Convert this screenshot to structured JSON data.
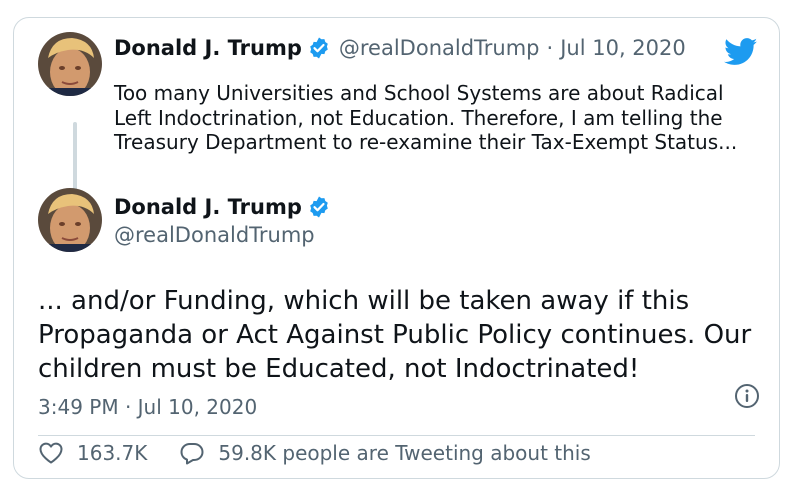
{
  "colors": {
    "verified": "#1d9bf0",
    "twitter_blue": "#1d9bf0",
    "text_primary": "#0f1419",
    "text_secondary": "#536471",
    "border": "#cfd9de"
  },
  "quoted_tweet": {
    "author_name": "Donald J. Trump",
    "handle": "@realDonaldTrump",
    "separator": "·",
    "date": "Jul 10, 2020",
    "text": "Too many Universities and School Systems are about Radical Left Indoctrination, not Education. Therefore, I am telling the Treasury Department to re-examine their Tax-Exempt Status...",
    "avatar_icon": "avatar-photo"
  },
  "main_tweet": {
    "author_name": "Donald J. Trump",
    "handle": "@realDonaldTrump",
    "text": "... and/or Funding, which will be taken away if this Propaganda or Act Against Public Policy continues. Our children must be Educated, not Indoctrinated!",
    "timestamp": "3:49 PM · Jul 10, 2020",
    "avatar_icon": "avatar-photo"
  },
  "icons": {
    "logo": "twitter-bird-icon",
    "verified": "verified-badge-icon",
    "info": "info-icon",
    "like": "heart-icon",
    "reply": "speech-bubble-icon"
  },
  "actions": {
    "likes": "163.7K",
    "tweeting": "59.8K people are Tweeting about this"
  }
}
